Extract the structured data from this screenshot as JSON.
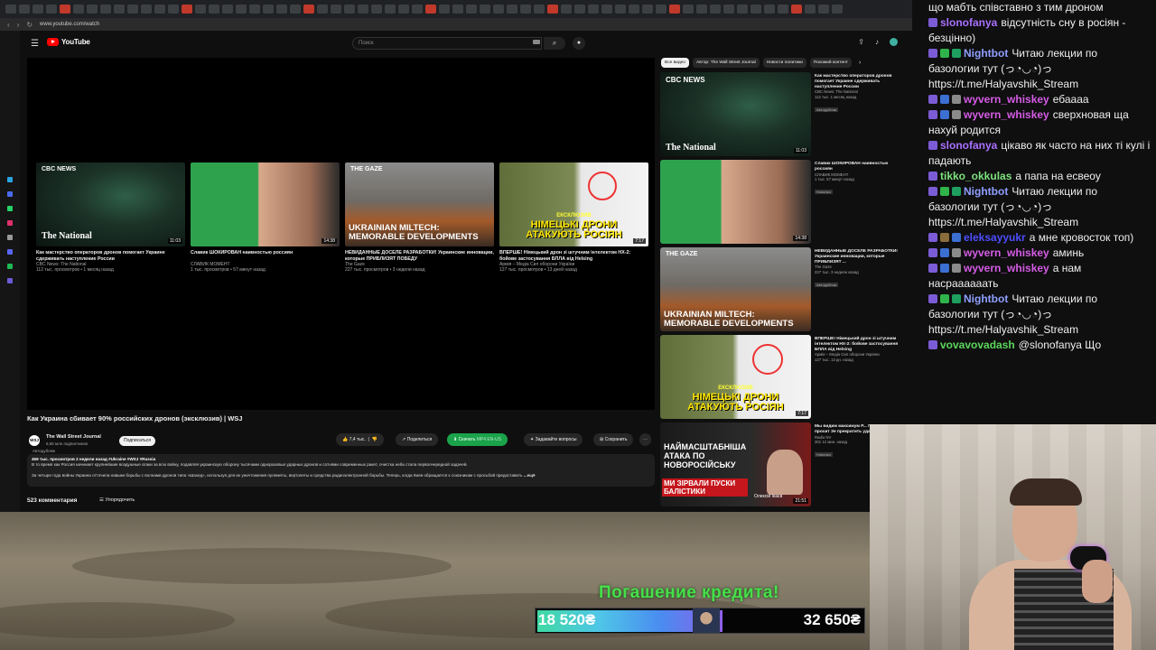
{
  "browser": {
    "url": "www.youtube.com/watch",
    "search_placeholder": "Поиск",
    "logo_text": "YouTube"
  },
  "video": {
    "title": "Как Украина сбивает 90% российских дронов (эксклюзив) | WSJ",
    "channel": "The Wall Street Journal",
    "subscribers": "6,65 млн подписчиков",
    "channel_badge": "WSJ",
    "autodub": "Автодубляж",
    "subscribe_label": "Подписаться",
    "likes": "7,4 тыс.",
    "share_label": "Поделиться",
    "download_label": "Скачать",
    "download_sub": "MP4 EN-US",
    "ask_label": "Задавайте вопросы",
    "save_label": "Сохранить",
    "desc_meta": "459 тыс. просмотров  2 недели назад  #Ukraine #WSJ #Russia",
    "desc_line1": "В то время как Россия начинает крупнейшие воздушные атаки за всю войну, подавляя украинскую оборону тысячами одноразовых ударных дронов и сотнями современных ракет, очистка неба стала первоочередной задачей.",
    "desc_line2": "За четыре года войны Украина отточила навыки борьбы с волнами дронов типа «Шахед», используя для их уничтожения пулеметы, вертолеты и средства радиоэлектронной борьбы. Теперь, когда Киев обращается к союзникам с просьбой предоставить",
    "more_label": "...ещё",
    "comments": "523 комментария",
    "sort_label": "Упорядочить"
  },
  "endcards": [
    {
      "title": "Как мастерство операторов дронов помогает Украине сдерживать наступление России",
      "channel": "CBC News: The National",
      "meta": "112 тыс. просмотров • 1 месяц назад",
      "duration": "11:03",
      "logo": "CBC NEWS",
      "brand": "The National"
    },
    {
      "title": "Славик ШОКИРОВАН наивностью россиян",
      "channel": "СЛАВИК МОМЕНТ",
      "meta": "1 тыс. просмотров • 57 минут назад",
      "duration": "14:38"
    },
    {
      "title": "НЕВИДАННЫЕ ДОСЕЛЕ РАЗРАБОТКИ! Украинские инновации, которые ПРИБЛИЗЯТ ПОБЕДУ",
      "channel": "The Gaze",
      "meta": "227 тыс. просмотров • 3 недели назад",
      "duration": "",
      "logo": "THE GAZE",
      "big": "UKRAINIAN MILTECH: MEMORABLE DEVELOPMENTS"
    },
    {
      "title": "ВПЕРШЕ! Німецький дрон зі штучним інтелектом HX-2: бойове застосування БПЛА від Helsing",
      "channel": "Армія – Медіа Сил оборони України",
      "meta": "127 тыс. просмотров • 13 дней назад",
      "duration": "7:17",
      "tag": "ЕКСКЛЮЗИВ",
      "big": "НІМЕЦЬКІ ДРОНИ АТАКУЮТЬ РОСІЯН"
    }
  ],
  "chips": [
    "Все видео",
    "Автор: The Wall Street Journal",
    "Новости политики",
    "Похожий контент"
  ],
  "recommendations": [
    {
      "title": "Как мастерство операторов дронов помогает Украине сдерживать наступление России",
      "channel": "CBC News: The National",
      "meta": "112 тыс.  1 месяц назад",
      "badge": "Автодубляж",
      "duration": "11:03",
      "logo": "CBC NEWS",
      "brand": "The National"
    },
    {
      "title": "Славик ШОКИРОВАН наивностью россиян",
      "channel": "СЛАВИК МОМЕНТ",
      "meta": "1 тыс.  57 минут назад",
      "badge": "Новинка",
      "duration": "14:38"
    },
    {
      "title": "НЕВИДАННЫЕ ДОСЕЛЕ РАЗРАБОТКИ! Украинские инновации, которые ПРИБЛИЗЯТ ...",
      "channel": "The Gaze",
      "meta": "227 тыс.  3 недели назад",
      "badge": "Автодубляж",
      "duration": "",
      "logo": "THE GAZE",
      "big": "UKRAINIAN MILTECH: MEMORABLE DEVELOPMENTS"
    },
    {
      "title": "ВПЕРШЕ! Німецький дрон зі штучним інтелектом HX-2: бойове застосування БПЛА від Helsing",
      "channel": "Армія – Медіа Сил оборони України",
      "meta": "127 тыс.  13 дн. назад",
      "badge": "",
      "duration": "7:17",
      "tag": "ЕКСКЛЮЗИВ",
      "big": "НІМЕЦЬКІ ДРОНИ АТАКУЮТЬ РОСІЯН"
    },
    {
      "title": "Мы видим максимум Р... Почему Венс просит Зе прекратить удары | Ана",
      "channel": "Radio NV",
      "meta": "301  12 мин. назад",
      "badge": "Новинка",
      "duration": "21:51",
      "big": "НАЙМАСШТАБНІША АТАКА ПО НОВОРОСІЙСЬКУ",
      "sub": "МИ ЗІРВАЛИ ПУСКИ БАЛІСТИКИ",
      "person": "Олексій Ікаєв"
    }
  ],
  "overlay": {
    "credit_title": "Погашение кредита!",
    "credit_current": "18 520₴",
    "credit_target": "32 650₴",
    "progress": 0.567
  },
  "chat": [
    {
      "user": "",
      "color": "#efeff1",
      "text": "що мабть співставно з тим дроном",
      "badges": []
    },
    {
      "user": "slonofanya",
      "color": "#a970ff",
      "text": "відсутність сну в росіян - безцінно)",
      "badges": [
        "#7b5cd6"
      ]
    },
    {
      "user": "Nightbot",
      "color": "#8f9fff",
      "text": "Читаю лекции по базологии тут (っ◔◡◔)っ https://t.me/Halyavshik_Stream",
      "badges": [
        "#7b5cd6",
        "#2fb34a",
        "#1e9f5f"
      ]
    },
    {
      "user": "wyvern_whiskey",
      "color": "#d55ce6",
      "text": "ебаааа",
      "badges": [
        "#7b5cd6",
        "#3b6fd1",
        "#8a8a8a"
      ]
    },
    {
      "user": "wyvern_whiskey",
      "color": "#d55ce6",
      "text": "сверхновая ща нахуй родится",
      "badges": [
        "#7b5cd6",
        "#3b6fd1",
        "#8a8a8a"
      ]
    },
    {
      "user": "slonofanya",
      "color": "#a970ff",
      "text": "цікаво як часто на них ті кулі і падають",
      "badges": [
        "#7b5cd6"
      ]
    },
    {
      "user": "tikko_okkulas",
      "color": "#7de27d",
      "text": "а папа на есвеоу",
      "badges": [
        "#7b5cd6"
      ]
    },
    {
      "user": "Nightbot",
      "color": "#8f9fff",
      "text": "Читаю лекции по базологии тут (っ◔◡◔)っ https://t.me/Halyavshik_Stream",
      "badges": [
        "#7b5cd6",
        "#2fb34a",
        "#1e9f5f"
      ]
    },
    {
      "user": "eleksayyukr",
      "color": "#4d4dff",
      "text": "а мне кровосток топ)",
      "badges": [
        "#7b5cd6",
        "#8a6d3b",
        "#3b6fd1"
      ]
    },
    {
      "user": "wyvern_whiskey",
      "color": "#d55ce6",
      "text": "аминь",
      "badges": [
        "#7b5cd6",
        "#3b6fd1",
        "#8a8a8a"
      ]
    },
    {
      "user": "wyvern_whiskey",
      "color": "#d55ce6",
      "text": "а нам насраааааать",
      "badges": [
        "#7b5cd6",
        "#3b6fd1",
        "#8a8a8a"
      ]
    },
    {
      "user": "Nightbot",
      "color": "#8f9fff",
      "text": "Читаю лекции по базологии тут (っ◔◡◔)っ https://t.me/Halyavshik_Stream",
      "badges": [
        "#7b5cd6",
        "#2fb34a",
        "#1e9f5f"
      ]
    },
    {
      "user": "vovavovadash",
      "color": "#5cd65c",
      "text": "@slonofanya Що",
      "badges": [
        "#7b5cd6"
      ]
    }
  ]
}
